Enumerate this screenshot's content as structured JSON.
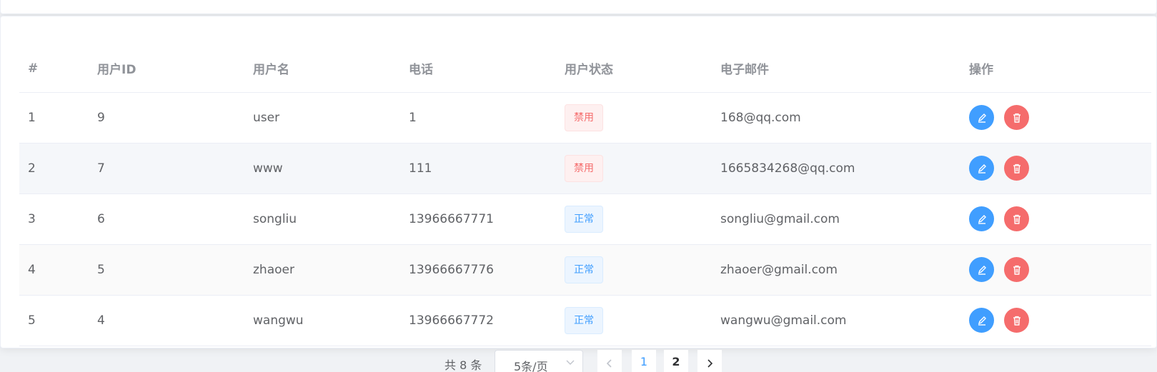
{
  "table": {
    "headers": [
      "#",
      "用户ID",
      "用户名",
      "电话",
      "用户状态",
      "电子邮件",
      "操作"
    ],
    "rows": [
      {
        "index": "1",
        "id": "9",
        "username": "user",
        "phone": "1",
        "status": "禁用",
        "email": "168@qq.com"
      },
      {
        "index": "2",
        "id": "7",
        "username": "www",
        "phone": "111",
        "status": "禁用",
        "email": "1665834268@qq.com"
      },
      {
        "index": "3",
        "id": "6",
        "username": "songliu",
        "phone": "13966667771",
        "status": "正常",
        "email": "songliu@gmail.com"
      },
      {
        "index": "4",
        "id": "5",
        "username": "zhaoer",
        "phone": "13966667776",
        "status": "正常",
        "email": "zhaoer@gmail.com"
      },
      {
        "index": "5",
        "id": "4",
        "username": "wangwu",
        "phone": "13966667772",
        "status": "正常",
        "email": "wangwu@gmail.com"
      }
    ],
    "actions": {
      "edit_icon": "edit-icon",
      "delete_icon": "delete-icon"
    }
  },
  "pagination": {
    "total_text": "共 8 条",
    "page_size": "5条/页",
    "pages": [
      "1",
      "2"
    ],
    "current_page": "1"
  },
  "colors": {
    "primary": "#409eff",
    "danger": "#f56c6c",
    "header_text": "#909399"
  }
}
